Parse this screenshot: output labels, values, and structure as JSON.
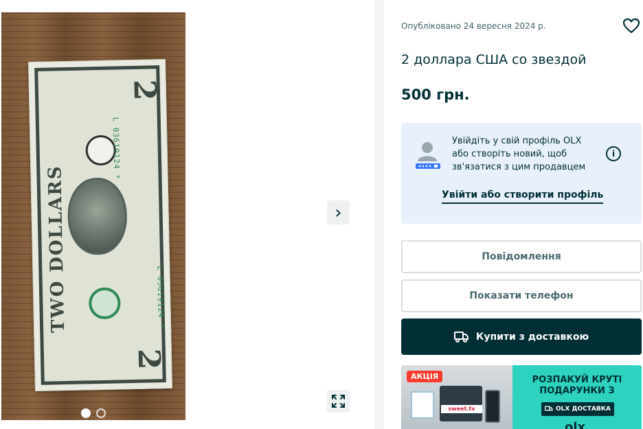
{
  "listing": {
    "published": "Опубліковано 24 вересня 2024 р.",
    "title": "2 доллара США со звездой",
    "price": "500 грн."
  },
  "login_card": {
    "text": "Увійдіть у свій профіль OLX або створіть новий, щоб зв'язатися з цим продавцем",
    "link": "Увійти або створити профіль",
    "info_glyph": "i"
  },
  "actions": {
    "message": "Повідомлення",
    "phone": "Показати телефон",
    "buy": "Купити з доставкою"
  },
  "gallery": {
    "next_glyph": "›",
    "photo_count": 2,
    "active_index": 1,
    "banknote": {
      "serial": "L 03619124 *",
      "denomination": "2",
      "side_text": "TWO DOLLARS"
    }
  },
  "promo": {
    "badge": "АКЦІЯ",
    "brand_tag": "sweet.tv",
    "headline": "РОЗПАКУЙ КРУТІ ПОДАРУНКИ З",
    "delivery": "OLX ДОСТАВКА",
    "logo": "olx"
  },
  "colors": {
    "brand_dark": "#002f34",
    "login_card_bg": "#e8f0fc",
    "promo_teal": "#2ed3bf",
    "promo_badge": "#ff3b2f",
    "divider": "#f2f4f5"
  },
  "icons": [
    "heart-icon",
    "chevron-right-icon",
    "expand-icon",
    "info-icon",
    "truck-icon",
    "user-avatar-icon"
  ]
}
